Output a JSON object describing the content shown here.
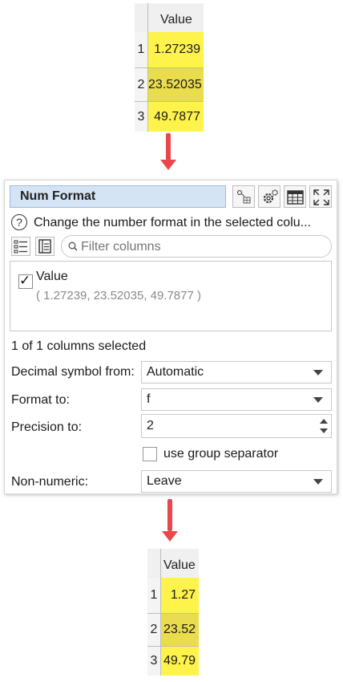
{
  "input_table": {
    "header": "Value",
    "rows": [
      {
        "num": "1",
        "value": "1.27239"
      },
      {
        "num": "2",
        "value": "23.52035"
      },
      {
        "num": "3",
        "value": "49.7877"
      }
    ]
  },
  "panel": {
    "title": "Num Format",
    "help_text": "Change the number format in the selected colu...",
    "filter_placeholder": "Filter columns",
    "column": {
      "name": "Value",
      "sample": "( 1.27239, 23.52035, 49.7877 )",
      "checked": "✓"
    },
    "status": "1 of 1 columns selected",
    "decimal_symbol": {
      "label": "Decimal symbol from:",
      "value": "Automatic"
    },
    "format_to": {
      "label": "Format to:",
      "value": "f"
    },
    "precision": {
      "label": "Precision to:",
      "value": "2"
    },
    "group_separator": {
      "label": "use group separator"
    },
    "non_numeric": {
      "label": "Non-numeric:",
      "value": "Leave"
    }
  },
  "output_table": {
    "header": "Value",
    "rows": [
      {
        "num": "1",
        "value": "1.27"
      },
      {
        "num": "2",
        "value": "23.52"
      },
      {
        "num": "3",
        "value": "49.79"
      }
    ]
  },
  "colors": {
    "cell_highlight": "#fef34b",
    "cell_highlight_dark": "#e9dc4d",
    "arrow": "#e8474b",
    "title_bg": "#d4e4f5"
  }
}
